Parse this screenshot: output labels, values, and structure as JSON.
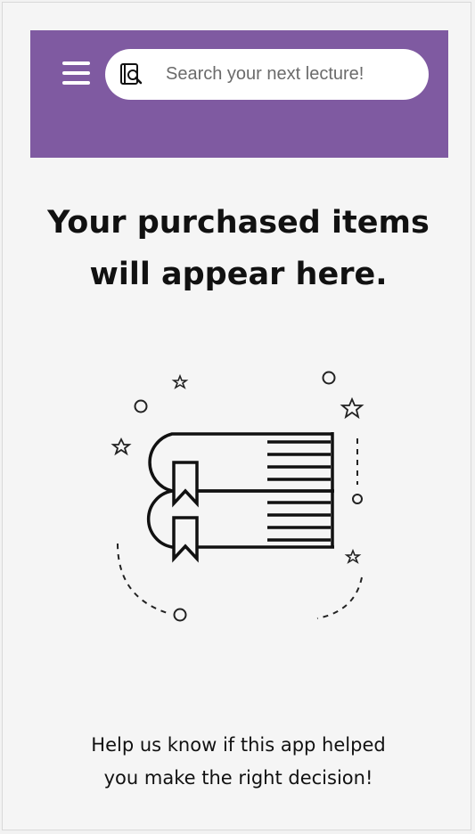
{
  "header": {
    "background_color": "#7f5aa1",
    "menu_icon": "hamburger-menu-icon",
    "search": {
      "icon": "book-search-icon",
      "placeholder": "Search your next lecture!"
    }
  },
  "empty_state": {
    "title_line1": "Your purchased items",
    "title_line2": "will appear here.",
    "illustration_icon": "books-bookmark-icon"
  },
  "footer": {
    "line1": "Help us know if this app helped",
    "line2": "you make the right decision!"
  }
}
